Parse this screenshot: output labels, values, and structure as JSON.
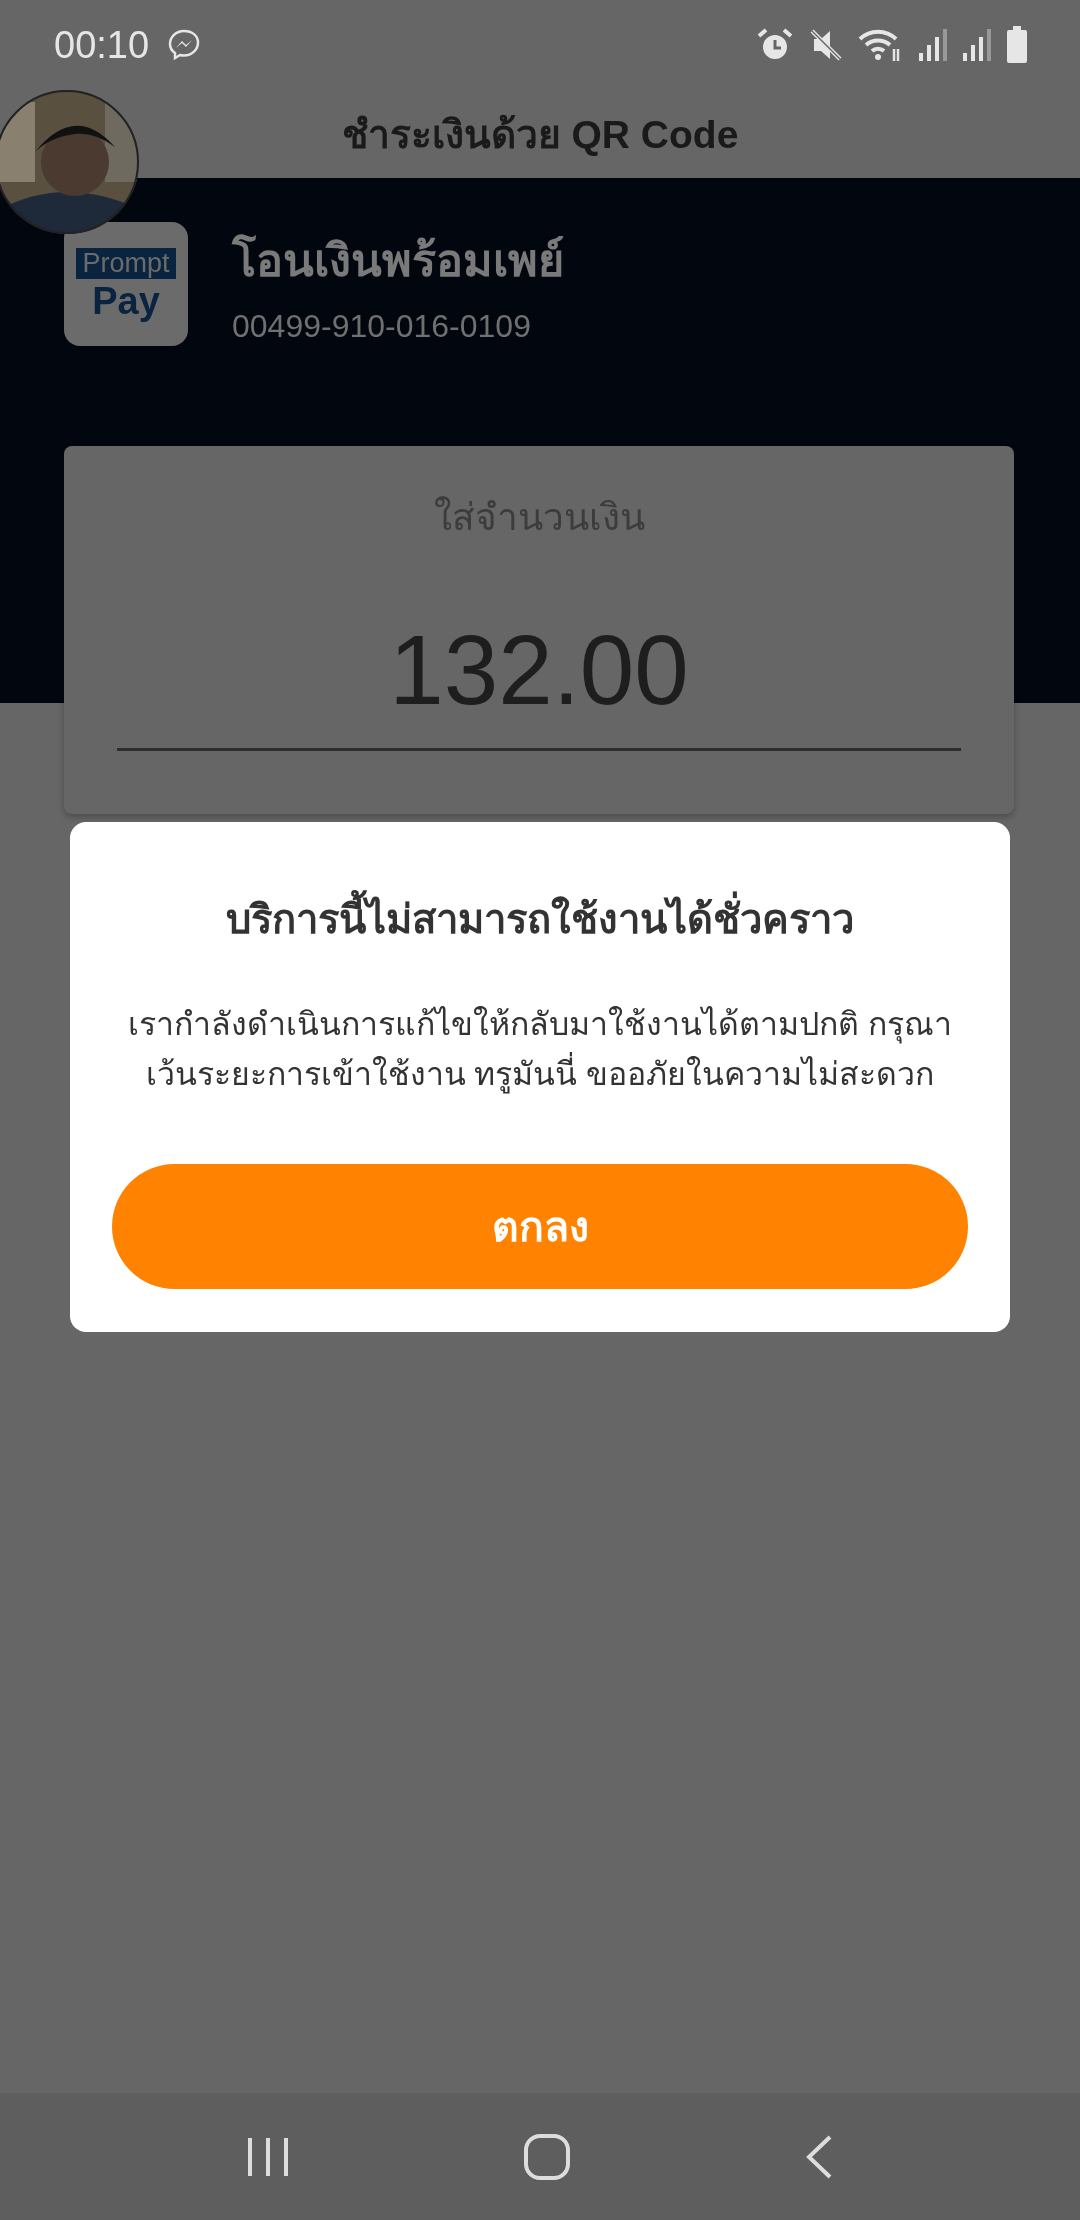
{
  "status_bar": {
    "time": "00:10"
  },
  "header": {
    "title": "ชำระเงินด้วย QR Code"
  },
  "payee": {
    "logo_top": "Prompt",
    "logo_bottom": "Pay",
    "name": "โอนเงินพร้อมเพย์",
    "account": "00499-910-016-0109"
  },
  "amount_card": {
    "label": "ใส่จำนวนเงิน",
    "value": "132.00"
  },
  "dialog": {
    "title": "บริการนี้ไม่สามารถใช้งานได้ชั่วคราว",
    "message_lines": [
      "เรากำลังดำเนินการแก้ไขให้กลับมาใช้งานได้ตามปกติ กรุณา",
      "เว้นระยะการเข้าใช้งาน ทรูมันนี่ ขออภัยในความไม่สะดวก"
    ],
    "button": "ตกลง"
  }
}
